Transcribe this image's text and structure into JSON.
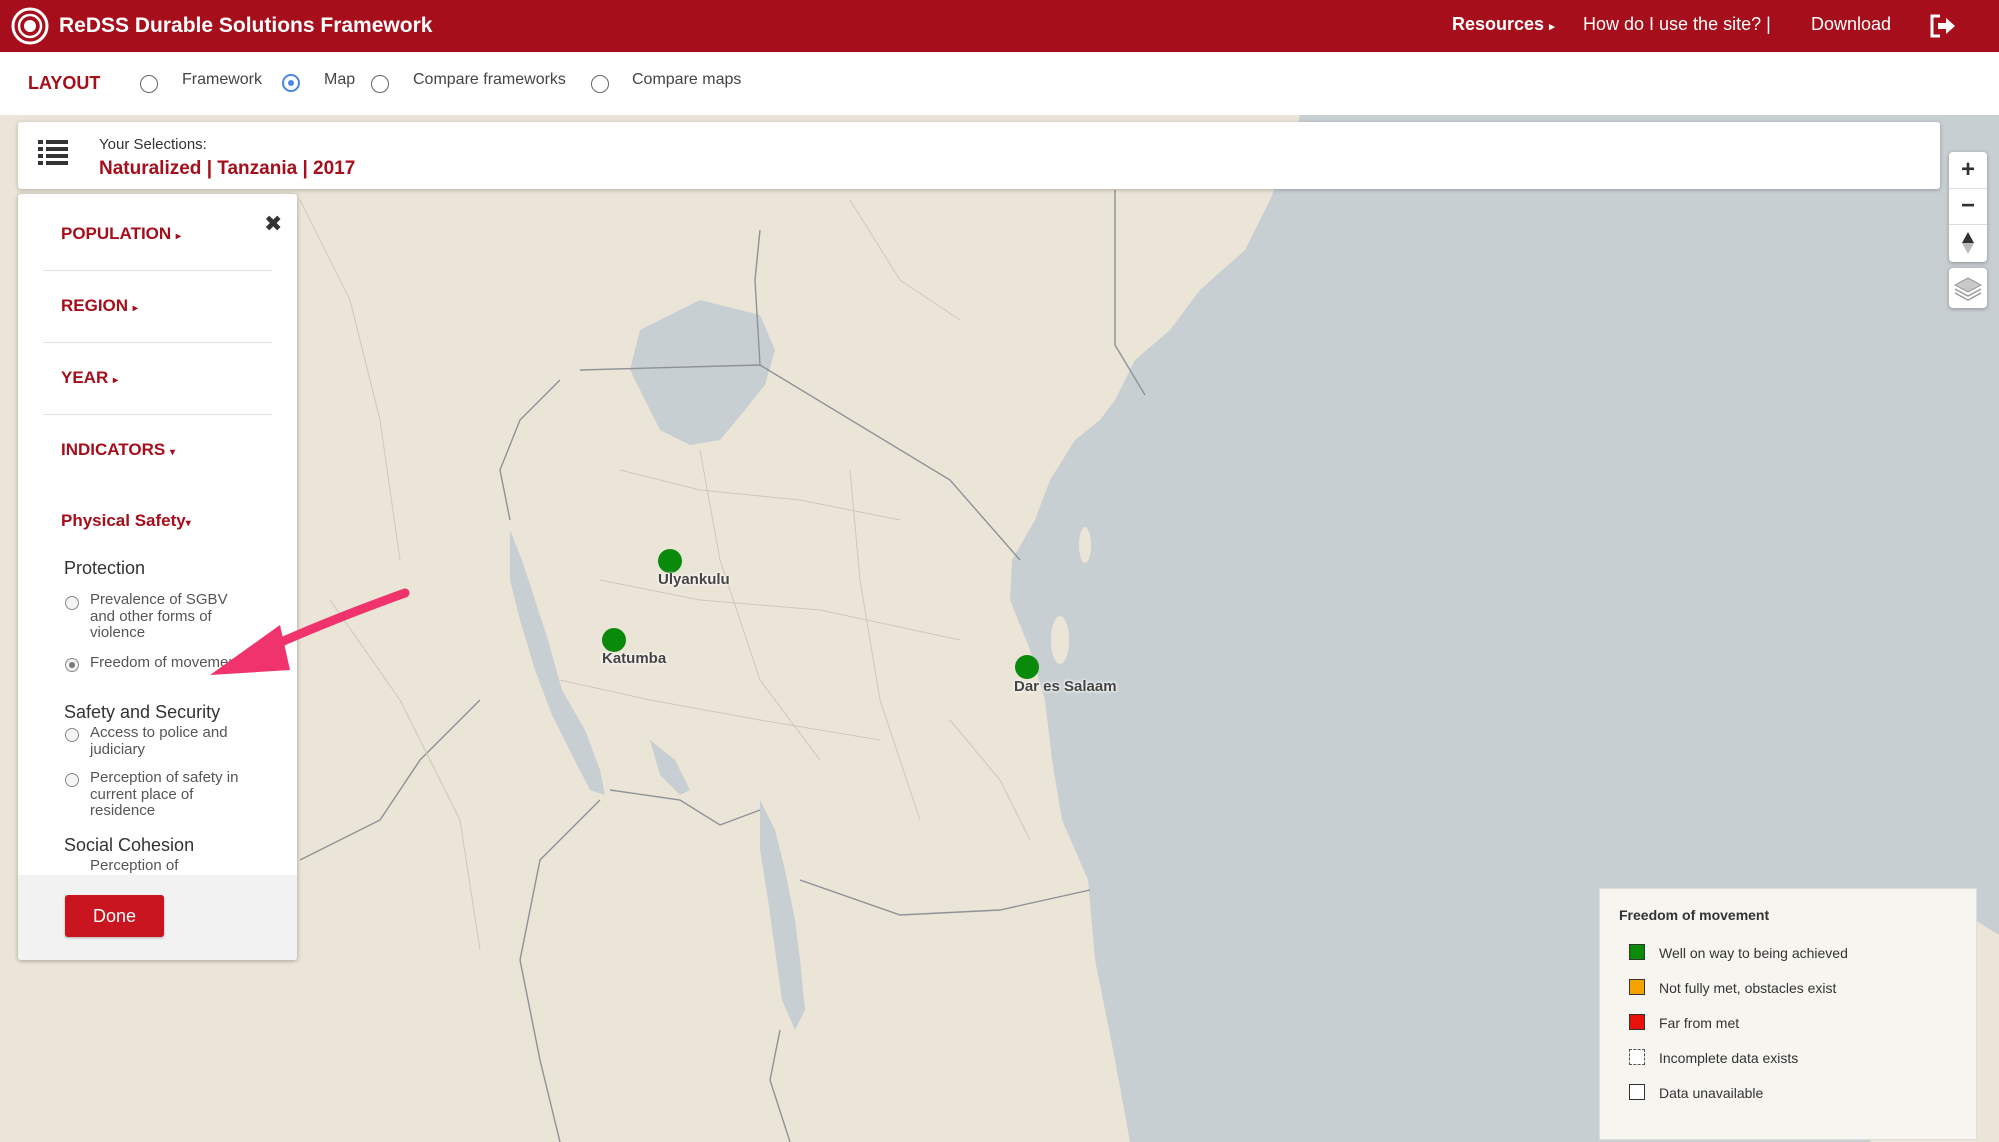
{
  "header": {
    "app_title": "ReDSS Durable Solutions Framework",
    "resources": "Resources",
    "help": "How do I use the site? |",
    "download": "Download"
  },
  "layout": {
    "label": "LAYOUT",
    "options": [
      "Framework",
      "Map",
      "Compare frameworks",
      "Compare maps"
    ],
    "selected": "Map"
  },
  "selections": {
    "label": "Your Selections:",
    "value": "Naturalized | Tanzania | 2017"
  },
  "panel": {
    "menus": [
      "POPULATION",
      "REGION",
      "YEAR",
      "INDICATORS"
    ],
    "subcategory": "Physical Safety",
    "groups": [
      {
        "title": "Protection",
        "items": [
          {
            "label": "Prevalence of SGBV and other forms of violence",
            "selected": false
          },
          {
            "label": "Freedom of movement",
            "selected": true
          }
        ]
      },
      {
        "title": "Safety and Security",
        "items": [
          {
            "label": "Access to police and judiciary",
            "selected": false
          },
          {
            "label": "Perception of safety in current place of residence",
            "selected": false
          }
        ]
      },
      {
        "title": "Social Cohesion",
        "items": [
          {
            "label": "Perception of",
            "selected": false
          }
        ]
      }
    ],
    "done_label": "Done"
  },
  "map": {
    "markers": [
      {
        "name": "Ulyankulu",
        "status": "Well on way to being achieved"
      },
      {
        "name": "Katumba",
        "status": "Well on way to being achieved"
      },
      {
        "name": "Dar es Salaam",
        "status": "Well on way to being achieved"
      }
    ]
  },
  "legend": {
    "title": "Freedom of movement",
    "items": [
      {
        "label": "Well on way to being achieved",
        "color": "#0a8a0a"
      },
      {
        "label": "Not fully met, obstacles exist",
        "color": "#f5a300"
      },
      {
        "label": "Far from met",
        "color": "#e8120c"
      },
      {
        "label": "Incomplete data exists",
        "color": "#ffffff"
      },
      {
        "label": "Data unavailable",
        "color": "#ffffff"
      }
    ]
  },
  "colors": {
    "brand": "#a50e1a",
    "accent_radio": "#4a86e8",
    "land": "#ebe5d8",
    "water": "#c8cfd2",
    "marker": "#0a8a0a",
    "arrow": "#f0336c"
  }
}
